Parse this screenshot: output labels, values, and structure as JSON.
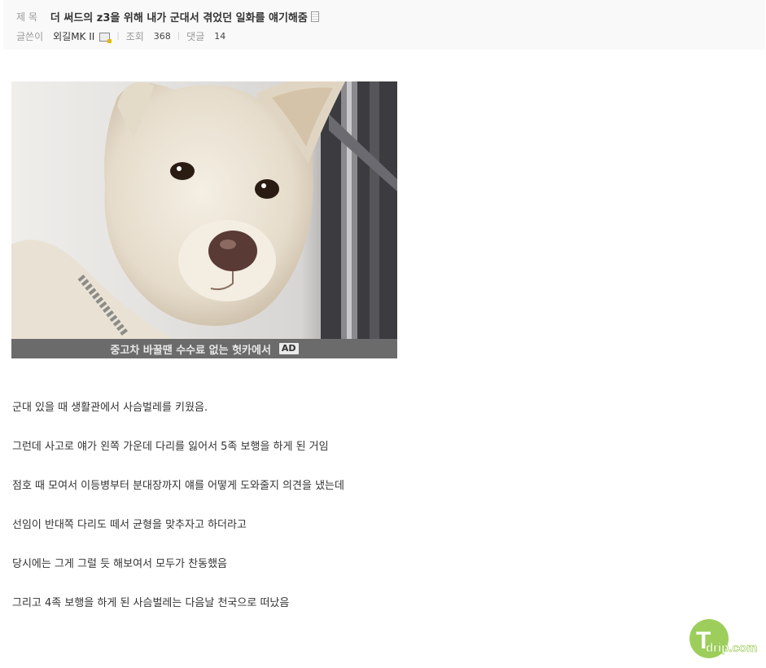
{
  "post": {
    "title_label": "제 목",
    "title": "더 써드의 z3을 위해 내가 군대서 겪었던 일화를 얘기해줌",
    "author_label": "글쓴이",
    "author": "외길MK II",
    "views_label": "조회",
    "views": "368",
    "comments_label": "댓글",
    "comments": "14"
  },
  "ad": {
    "text": "중고차 바꿀땐 수수료 없는 헛카에서",
    "badge": "AD"
  },
  "content": {
    "lines": [
      "군대 있을 때 생활관에서 사슴벌레를 키웠음.",
      "그런데 사고로 얘가 왼쪽 가운데 다리를 잃어서 5족 보행을 하게 된 거임",
      "점호 때 모여서 이등병부터 분대장까지 얘를 어떻게 도와줄지 의견을 냈는데",
      "선임이 반대쪽 다리도 떼서 균형을 맞추자고 하더라고",
      "당시에는 그게 그럴 듯 해보여서 모두가 찬동했음",
      "그리고 4족 보행을 하게 된 사슴벌레는 다음날 천국으로 떠났음"
    ]
  },
  "watermark": {
    "logo_text": "drip.com",
    "logo_letter": "T"
  },
  "colors": {
    "header_bg": "#f9f9f9",
    "ad_bar": "#6b6b6b",
    "logo_green": "#8cc63f"
  }
}
